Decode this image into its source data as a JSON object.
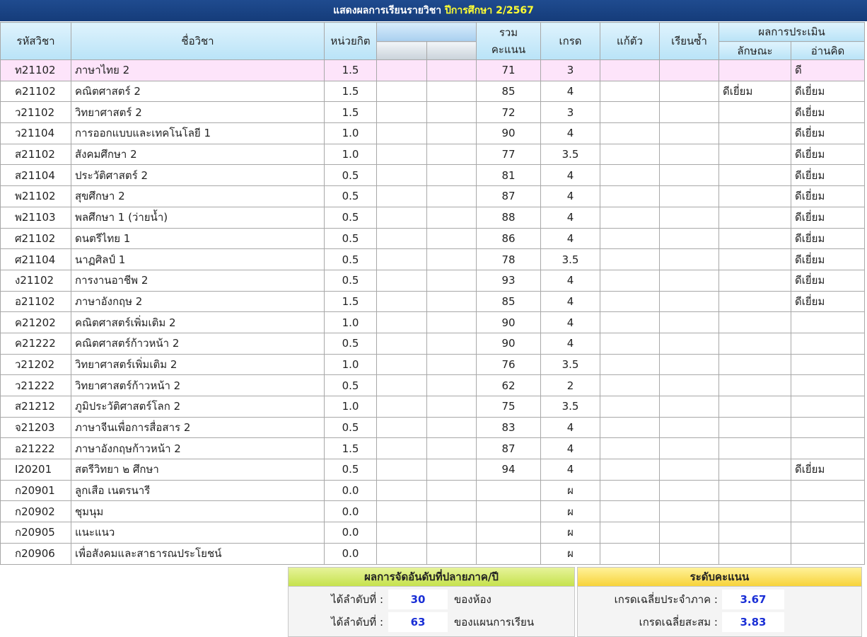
{
  "title": {
    "main": "แสดงผลการเรียนรายวิชา",
    "year": "ปีการศึกษา 2/2567"
  },
  "headers": {
    "code": "รหัสวิชา",
    "name": "ชื่อวิชา",
    "credits": "หน่วยกิต",
    "total_line1": "รวม",
    "total_line2": "คะแนน",
    "grade": "เกรด",
    "remedial": "แก้ตัว",
    "repeat": "เรียนซ้ำ",
    "evaluation": "ผลการประเมิน",
    "characteristic": "ลักษณะ",
    "reading": "อ่านคิด"
  },
  "rows": [
    {
      "code": "ท21102",
      "name": "ภาษาไทย 2",
      "credits": "1.5",
      "score": "71",
      "grade": "3",
      "char": "",
      "read": "ดี"
    },
    {
      "code": "ค21102",
      "name": "คณิตศาสตร์ 2",
      "credits": "1.5",
      "score": "85",
      "grade": "4",
      "char": "ดีเยี่ยม",
      "read": "ดีเยี่ยม"
    },
    {
      "code": "ว21102",
      "name": "วิทยาศาสตร์ 2",
      "credits": "1.5",
      "score": "72",
      "grade": "3",
      "char": "",
      "read": "ดีเยี่ยม"
    },
    {
      "code": "ว21104",
      "name": "การออกแบบและเทคโนโลยี 1",
      "credits": "1.0",
      "score": "90",
      "grade": "4",
      "char": "",
      "read": "ดีเยี่ยม"
    },
    {
      "code": "ส21102",
      "name": "สังคมศึกษา 2",
      "credits": "1.0",
      "score": "77",
      "grade": "3.5",
      "char": "",
      "read": "ดีเยี่ยม"
    },
    {
      "code": "ส21104",
      "name": "ประวัติศาสตร์ 2",
      "credits": "0.5",
      "score": "81",
      "grade": "4",
      "char": "",
      "read": "ดีเยี่ยม"
    },
    {
      "code": "พ21102",
      "name": "สุขศึกษา 2",
      "credits": "0.5",
      "score": "87",
      "grade": "4",
      "char": "",
      "read": "ดีเยี่ยม"
    },
    {
      "code": "พ21103",
      "name": "พลศึกษา 1 (ว่ายน้ำ)",
      "credits": "0.5",
      "score": "88",
      "grade": "4",
      "char": "",
      "read": "ดีเยี่ยม"
    },
    {
      "code": "ศ21102",
      "name": "ดนตรีไทย 1",
      "credits": "0.5",
      "score": "86",
      "grade": "4",
      "char": "",
      "read": "ดีเยี่ยม"
    },
    {
      "code": "ศ21104",
      "name": "นาฏศิลป์ 1",
      "credits": "0.5",
      "score": "78",
      "grade": "3.5",
      "char": "",
      "read": "ดีเยี่ยม"
    },
    {
      "code": "ง21102",
      "name": "การงานอาชีพ 2",
      "credits": "0.5",
      "score": "93",
      "grade": "4",
      "char": "",
      "read": "ดีเยี่ยม"
    },
    {
      "code": "อ21102",
      "name": "ภาษาอังกฤษ 2",
      "credits": "1.5",
      "score": "85",
      "grade": "4",
      "char": "",
      "read": "ดีเยี่ยม"
    },
    {
      "code": "ค21202",
      "name": "คณิตศาสตร์เพิ่มเติม 2",
      "credits": "1.0",
      "score": "90",
      "grade": "4",
      "char": "",
      "read": ""
    },
    {
      "code": "ค21222",
      "name": "คณิตศาสตร์ก้าวหน้า 2",
      "credits": "0.5",
      "score": "90",
      "grade": "4",
      "char": "",
      "read": ""
    },
    {
      "code": "ว21202",
      "name": "วิทยาศาสตร์เพิ่มเติม 2",
      "credits": "1.0",
      "score": "76",
      "grade": "3.5",
      "char": "",
      "read": ""
    },
    {
      "code": "ว21222",
      "name": "วิทยาศาสตร์ก้าวหน้า 2",
      "credits": "0.5",
      "score": "62",
      "grade": "2",
      "char": "",
      "read": ""
    },
    {
      "code": "ส21212",
      "name": "ภูมิประวัติศาสตร์โลก 2",
      "credits": "1.0",
      "score": "75",
      "grade": "3.5",
      "char": "",
      "read": ""
    },
    {
      "code": "จ21203",
      "name": "ภาษาจีนเพื่อการสื่อสาร 2",
      "credits": "0.5",
      "score": "83",
      "grade": "4",
      "char": "",
      "read": ""
    },
    {
      "code": "อ21222",
      "name": "ภาษาอังกฤษก้าวหน้า 2",
      "credits": "1.5",
      "score": "87",
      "grade": "4",
      "char": "",
      "read": ""
    },
    {
      "code": "I20201",
      "name": "สตรีวิทยา ๒ ศึกษา",
      "credits": "0.5",
      "score": "94",
      "grade": "4",
      "char": "",
      "read": "ดีเยี่ยม"
    },
    {
      "code": "ก20901",
      "name": "ลูกเสือ เนตรนารี",
      "credits": "0.0",
      "score": "",
      "grade": "ผ",
      "char": "",
      "read": ""
    },
    {
      "code": "ก20902",
      "name": "ชุมนุม",
      "credits": "0.0",
      "score": "",
      "grade": "ผ",
      "char": "",
      "read": ""
    },
    {
      "code": "ก20905",
      "name": "แนะแนว",
      "credits": "0.0",
      "score": "",
      "grade": "ผ",
      "char": "",
      "read": ""
    },
    {
      "code": "ก20906",
      "name": "เพื่อสังคมและสาธารณประโยชน์",
      "credits": "0.0",
      "score": "",
      "grade": "ผ",
      "char": "",
      "read": ""
    }
  ],
  "ranking": {
    "title": "ผลการจัดอันดับที่ปลายภาค/ปี",
    "class_label": "ได้ลำดับที่ :",
    "class_value": "30",
    "class_unit": "ของห้อง",
    "program_label": "ได้ลำดับที่ :",
    "program_value": "63",
    "program_unit": "ของแผนการเรียน"
  },
  "gpa": {
    "title": "ระดับคะแนน",
    "term_label": "เกรดเฉลี่ยประจำภาค :",
    "term_value": "3.67",
    "cum_label": "เกรดเฉลี่ยสะสม :",
    "cum_value": "3.83"
  }
}
